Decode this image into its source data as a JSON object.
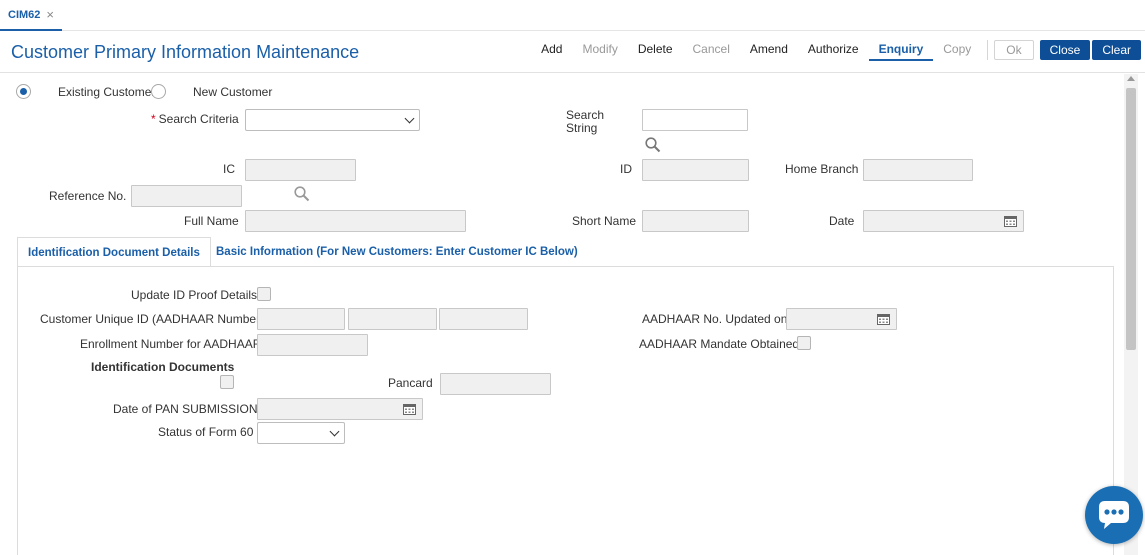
{
  "doc_tab": {
    "label": "CIM62",
    "close": "×"
  },
  "page_title": "Customer Primary Information Maintenance",
  "toolbar": {
    "add": "Add",
    "modify": "Modify",
    "delete": "Delete",
    "cancel": "Cancel",
    "amend": "Amend",
    "authorize": "Authorize",
    "enquiry": "Enquiry",
    "copy": "Copy",
    "ok": "Ok",
    "close": "Close",
    "clear": "Clear"
  },
  "customer_type": {
    "existing": "Existing Customer",
    "new": "New Customer",
    "selected": "existing"
  },
  "form": {
    "search_criteria": "Search Criteria",
    "search_string": "Search String",
    "ic": "IC",
    "id": "ID",
    "home_branch": "Home Branch",
    "reference_no": "Reference No.",
    "full_name": "Full Name",
    "short_name": "Short Name",
    "date": "Date"
  },
  "tabs": [
    {
      "label": "Identification Document Details",
      "active": true
    },
    {
      "label": "Basic Information (For New Customers: Enter Customer IC Below)",
      "active": false
    }
  ],
  "id_details": {
    "update_id_proof": "Update ID Proof Details",
    "customer_unique_id": "Customer Unique ID (AADHAAR Number)",
    "aadhaar_updated_on": "AADHAAR No. Updated on",
    "enrollment_number": "Enrollment Number for AADHAAR",
    "aadhaar_mandate": "AADHAAR Mandate Obtained",
    "identification_documents": "Identification Documents",
    "pancard": "Pancard",
    "date_pan_submission": "Date of PAN SUBMISSION",
    "status_form60": "Status of Form 60"
  },
  "colors": {
    "accent": "#1a5fa8",
    "primary_button": "#0d4e96",
    "chat_button": "#1a6fb4",
    "required": "#d0021b"
  }
}
